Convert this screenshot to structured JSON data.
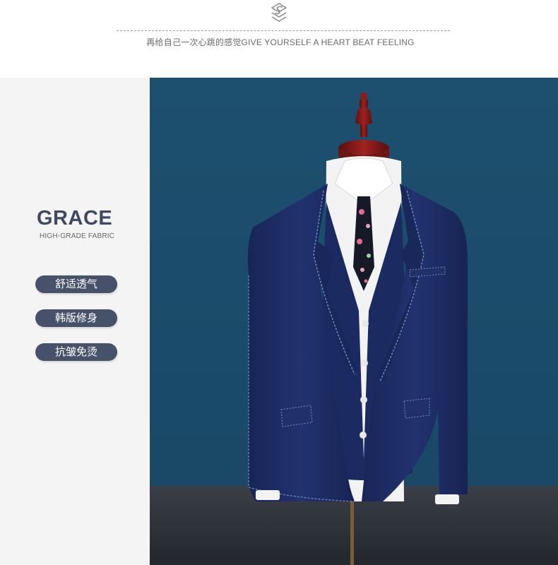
{
  "header": {
    "tagline": "再给自己一次心跳的感觉GIVE YOURSELF A HEART BEAT FEELING",
    "logo_icon": "s-logo-icon"
  },
  "feature": {
    "title": "GRACE",
    "subtitle": "HIGH-GRADE FABRIC",
    "tags": [
      "舒适透气",
      "韩版修身",
      "抗皱免烫"
    ]
  },
  "photo": {
    "subject": "suit-on-mannequin",
    "colors": {
      "backdrop": "#1d4f6e",
      "suit": "#1c2a5c",
      "panel": "#f4f4f4",
      "pill": "#46526a"
    }
  }
}
